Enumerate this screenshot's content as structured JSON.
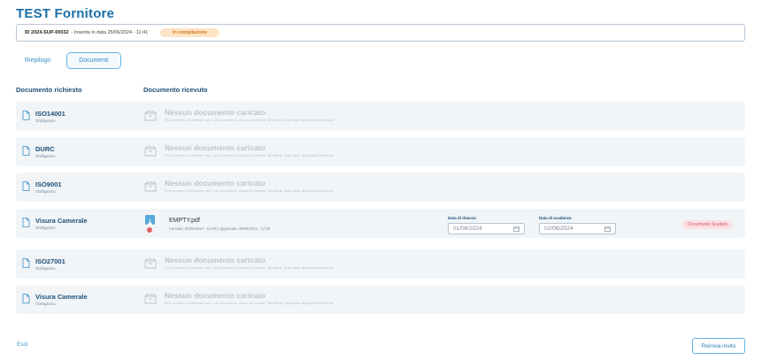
{
  "page": {
    "title": "TEST Fornitore",
    "id_label": "ID 2024-SUP-00032",
    "inserted_label": "- Inserita in data 25/06/2024 - 11:41",
    "status": "In compilazione"
  },
  "tabs": [
    {
      "label": "Riepilogo"
    },
    {
      "label": "Documenti"
    }
  ],
  "columns": {
    "requested": "Documento richiesto",
    "received": "Documento ricevuto"
  },
  "empty_state": {
    "title": "Nessun documento caricato",
    "description": "Per caricare o modificare uno o più documenti, clicca sul bottone \"Modifica\" (dopo aver approvato il fornitore."
  },
  "documents": [
    {
      "name": "ISO14001",
      "requirement": "Obbligatorio"
    },
    {
      "name": "DURC",
      "requirement": "Obbligatorio"
    },
    {
      "name": "ISO9001",
      "requirement": "Obbligatorio"
    },
    {
      "name": "Visura Camerale",
      "requirement": "Obbligatorio",
      "file_name": "EMPTY.pdf",
      "file_meta": "Caricato: 20/06/2024 - 12:08 | Aggiornato: 20/06/2024 - 12:09",
      "issue_label": "Data di rilascio",
      "issue_date": "01/06/2024",
      "expiry_label": "Data di scadenza",
      "expiry_date": "02/06/2024",
      "badge": "Documento Scaduto"
    },
    {
      "name": "ISO27001",
      "requirement": "Obbligatorio"
    },
    {
      "name": "Visura Camerale",
      "requirement": "Obbligatorio"
    }
  ],
  "footer": {
    "exit_label": "Esci",
    "resend_label": "Reinvia invito"
  },
  "colors": {
    "accent": "#1b6fa8",
    "status_bg": "#fde4c6",
    "status_text": "#d9791a",
    "expired_bg": "#fbdfe2",
    "expired_text": "#e25465"
  }
}
